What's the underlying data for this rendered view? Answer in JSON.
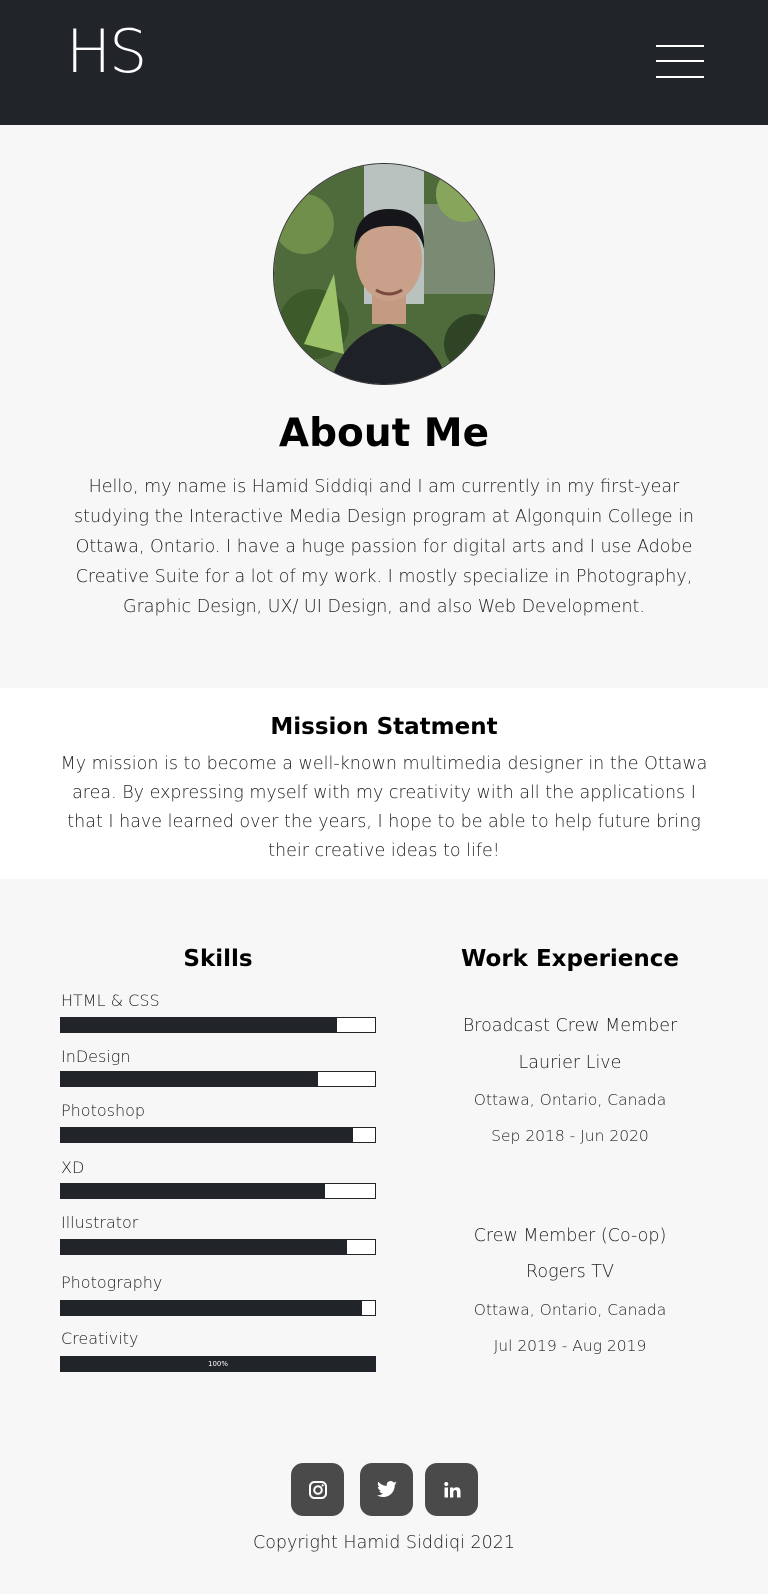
{
  "header": {
    "logo": "HS",
    "menu_icon": "hamburger-menu-icon"
  },
  "about": {
    "title": "About Me",
    "body": "Hello, my name is Hamid Siddiqi and I am currently in my first-year studying the Interactive Media Design program at Algonquin College in Ottawa, Ontario. I have a huge passion for digital arts and I use Adobe Creative Suite for a lot of my work. I mostly specialize in Photography, Graphic Design, UX/ UI Design, and also Web Development."
  },
  "mission": {
    "title": "Mission Statment",
    "body": "My mission is to become a well-known multimedia designer in the Ottawa area. By expressing myself with my creativity with all the applications I that I have learned over the years, I hope to be able to help future bring their creative ideas to life!"
  },
  "skills": {
    "title": "Skills",
    "items": [
      {
        "label": "HTML & CSS",
        "level": 0.88
      },
      {
        "label": "InDesign",
        "level": 0.82
      },
      {
        "label": "Photoshop",
        "level": 0.93
      },
      {
        "label": "XD",
        "level": 0.84
      },
      {
        "label": "Illustrator",
        "level": 0.91
      },
      {
        "label": "Photography",
        "level": 0.96
      },
      {
        "label": "Creativity",
        "level": 1.0,
        "bar_text": "100%"
      }
    ]
  },
  "work": {
    "title": "Work Experience",
    "jobs": [
      {
        "role": "Broadcast Crew Member",
        "company": "Laurier Live",
        "location": "Ottawa, Ontario, Canada",
        "dates": "Sep 2018 - Jun 2020"
      },
      {
        "role": "Crew Member (Co-op)",
        "company": "Rogers TV",
        "location": "Ottawa, Ontario, Canada",
        "dates": "Jul 2019 - Aug 2019"
      }
    ]
  },
  "footer": {
    "social_icons": [
      "instagram-icon",
      "twitter-icon",
      "linkedin-icon"
    ],
    "copyright": "Copyright Hamid Siddiqi 2021"
  },
  "colors": {
    "header_bg": "#212429",
    "page_bg": "#f7f7f7",
    "bar_fill": "#212429",
    "social_bg": "#4a4a4a"
  }
}
